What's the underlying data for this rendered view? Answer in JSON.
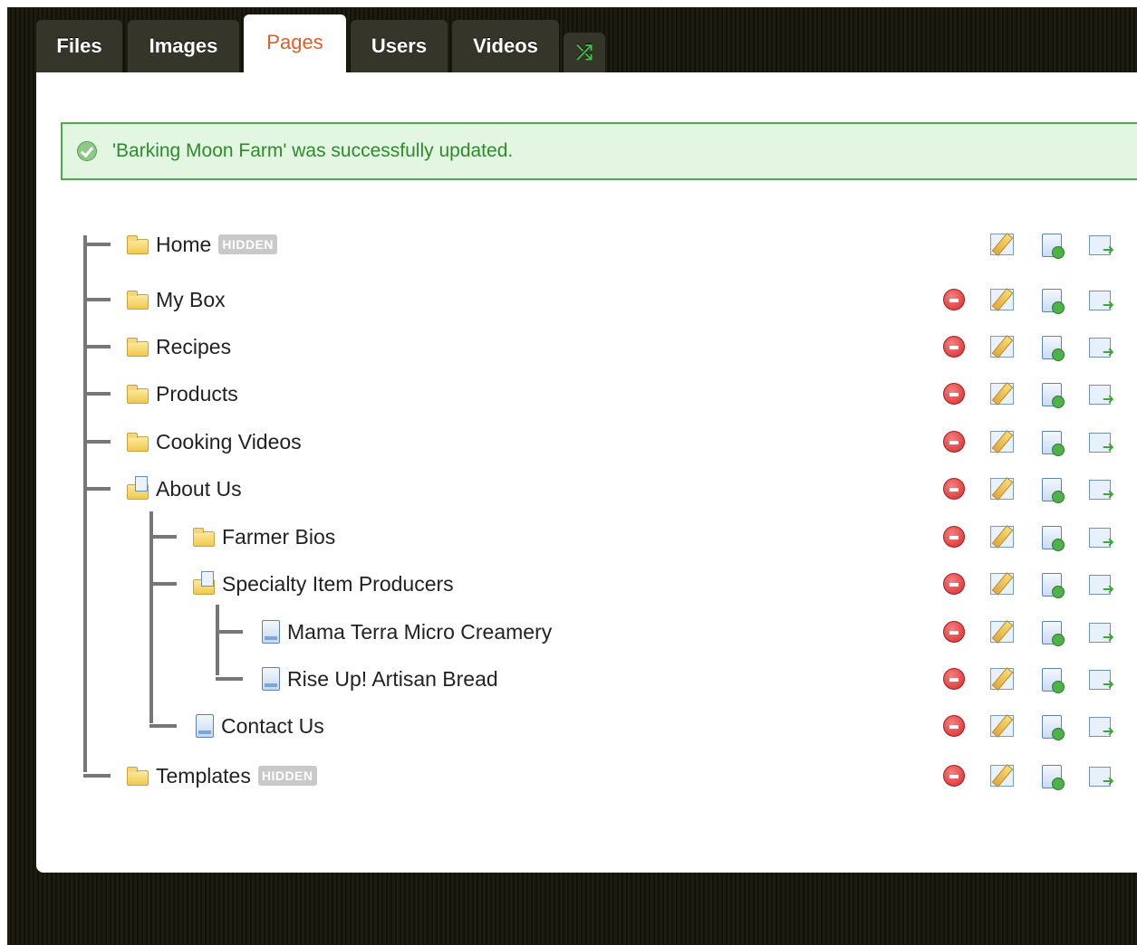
{
  "tabs": [
    {
      "label": "Files",
      "active": false
    },
    {
      "label": "Images",
      "active": false
    },
    {
      "label": "Pages",
      "active": true
    },
    {
      "label": "Users",
      "active": false
    },
    {
      "label": "Videos",
      "active": false
    }
  ],
  "shuffle_icon": "shuffle-icon",
  "flash": {
    "message": "'Barking Moon Farm' was successfully updated.",
    "icon": "check-circle-icon"
  },
  "tree": [
    {
      "label": "Home",
      "badge": "HIDDEN",
      "icon": "folder-icon",
      "depth": 0,
      "deletable": false
    },
    {
      "label": "My Box",
      "icon": "folder-icon",
      "depth": 0,
      "deletable": true
    },
    {
      "label": "Recipes",
      "icon": "folder-icon",
      "depth": 0,
      "deletable": true
    },
    {
      "label": "Products",
      "icon": "folder-icon",
      "depth": 0,
      "deletable": true
    },
    {
      "label": "Cooking Videos",
      "icon": "folder-icon",
      "depth": 0,
      "deletable": true
    },
    {
      "label": "About Us",
      "icon": "folder-page-icon",
      "depth": 0,
      "deletable": true
    },
    {
      "label": "Farmer Bios",
      "icon": "folder-icon",
      "depth": 1,
      "deletable": true
    },
    {
      "label": "Specialty Item Producers",
      "icon": "folder-page-icon",
      "depth": 1,
      "deletable": true
    },
    {
      "label": "Mama Terra Micro Creamery",
      "icon": "page-icon",
      "depth": 2,
      "deletable": true
    },
    {
      "label": "Rise Up! Artisan Bread",
      "icon": "page-icon",
      "depth": 2,
      "deletable": true
    },
    {
      "label": "Contact Us",
      "icon": "page-icon",
      "depth": 1,
      "deletable": true
    },
    {
      "label": "Templates",
      "badge": "HIDDEN",
      "icon": "folder-icon",
      "depth": 0,
      "deletable": true
    }
  ],
  "action_icons": [
    "delete-icon",
    "edit-icon",
    "add-page-icon",
    "move-page-icon"
  ],
  "colors": {
    "active_tab_text": "#e35d26",
    "flash_text": "#2e8b2c",
    "flash_bg": "#e3f6e2",
    "tab_bg": "#353529"
  }
}
